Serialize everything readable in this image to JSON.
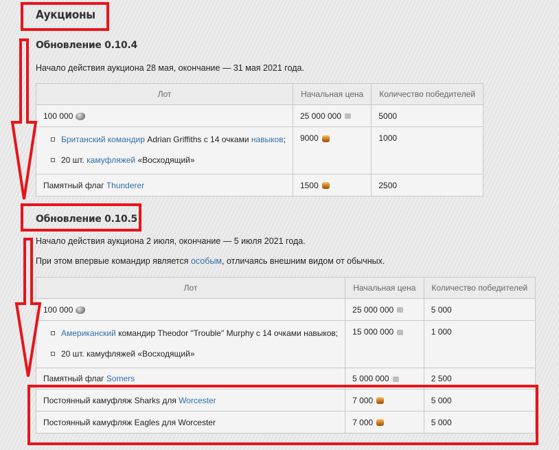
{
  "page": {
    "title": "Аукционы",
    "accent_red": "#e8141b",
    "link_color": "#2f6fab"
  },
  "section1": {
    "heading": "Обновление 0.10.4",
    "intro": "Начало действия аукциона 28 мая, окончание — 31 мая 2021 года.",
    "headers": [
      "Лот",
      "Начальная цена",
      "Количество победителей"
    ],
    "row1": {
      "lot": "100 000",
      "price": "25 000 000",
      "winners": "5000"
    },
    "row2": {
      "item1_link1": "Британский командир",
      "item1_text": " Adrian Griffiths с 14 очками ",
      "item1_link2": "навыков",
      "item1_tail": ";",
      "item2_text": "20 шт. ",
      "item2_link": "камуфляжей",
      "item2_tail": " «Восходящий»",
      "price": "9000",
      "winners": "1000"
    },
    "row3": {
      "lot_text": "Памятный флаг ",
      "lot_link": "Thunderer",
      "price": "1500",
      "winners": "2500"
    }
  },
  "section2": {
    "heading": "Обновление 0.10.5",
    "intro": "Начало действия аукциона 2 июля, окончание — 5 июля 2021 года.",
    "note_text": "При этом впервые командир является ",
    "note_link": "особым",
    "note_tail": ", отличаясь внешним видом от обычных.",
    "headers": [
      "Лот",
      "Начальная цена",
      "Количество победителей"
    ],
    "row1": {
      "lot": "100 000",
      "price": "25 000 000",
      "winners": "5 000"
    },
    "row2": {
      "item1_link": "Американский",
      "item1_text": " командир Theodor \"Trouble\" Murphy с 14 очками навыков;",
      "item2_text": "20 шт. камуфляжей «Восходящий»",
      "price": "15 000 000",
      "winners": "1 000"
    },
    "row3": {
      "lot_text": "Памятный флаг ",
      "lot_link": "Somers",
      "price": "5 000 000",
      "winners": "2 500"
    },
    "row4": {
      "lot_text": "Постоянный камуфляж Sharks для ",
      "lot_link": "Worcester",
      "price": "7 000",
      "winners": "5 000"
    },
    "row5": {
      "lot_text": "Постоянный камуфляж Eagles для Worcester",
      "price": "7 000",
      "winners": "5 000"
    }
  },
  "icons": {
    "silver": "silver-icon",
    "gold": "doubloon-icon",
    "credit": "credit-icon"
  }
}
